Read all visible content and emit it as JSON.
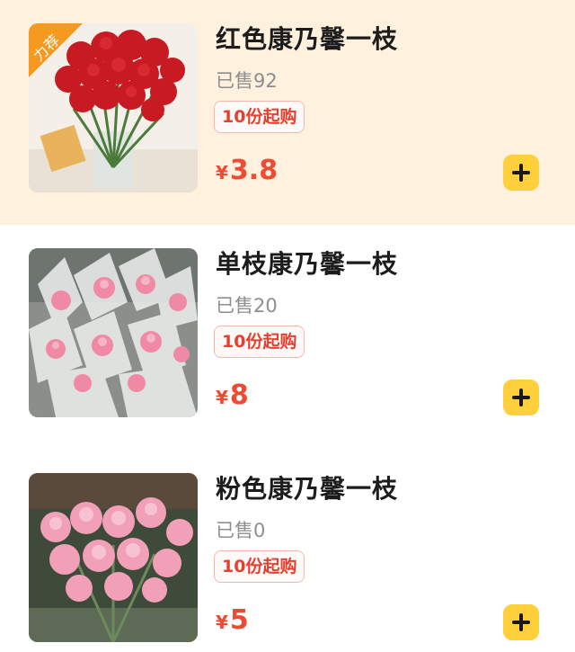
{
  "products": [
    {
      "name": "红色康乃馨一枝",
      "sold": "已售92",
      "min_order": "10份起购",
      "currency": "¥",
      "price": "3.8",
      "badge": "力荐",
      "flower_color": "#c81a22",
      "flower_color_light": "#e03038"
    },
    {
      "name": "单枝康乃馨一枝",
      "sold": "已售20",
      "min_order": "10份起购",
      "currency": "¥",
      "price": "8",
      "flower_color": "#f08aa4",
      "flower_color_light": "#f7b8c8"
    },
    {
      "name": "粉色康乃馨一枝",
      "sold": "已售0",
      "min_order": "10份起购",
      "currency": "¥",
      "price": "5",
      "flower_color": "#f2a0b8",
      "flower_color_light": "#f9cad8"
    }
  ],
  "colors": {
    "highlight_bg": "#fff1de",
    "price": "#ef4b32",
    "add_button": "#ffd03b",
    "badge": "#f59a1f"
  }
}
